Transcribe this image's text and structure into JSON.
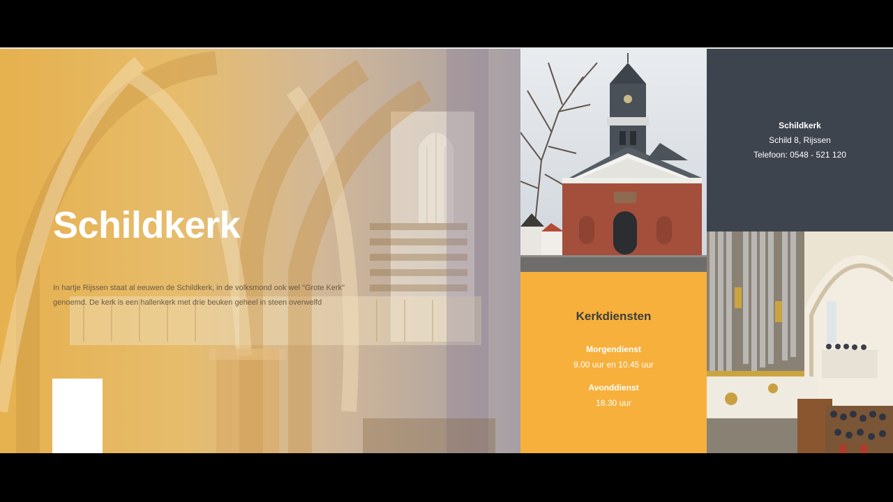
{
  "hero": {
    "title": "Schildkerk",
    "text": "In hartje Rijssen staat al eeuwen de Schildkerk, in de volksmond ook wel \"Grote Kerk\" genoemd. De kerk is een hallenkerk met drie beuken geheel in steen overwelfd"
  },
  "info": {
    "name": "Schildkerk",
    "address": "Schild 8, Rijssen",
    "phone": "Telefoon: 0548 - 521 120"
  },
  "services": {
    "heading": "Kerkdiensten",
    "items": [
      {
        "title": "Morgendienst",
        "time": "9.00 uur en 10.45 uur"
      },
      {
        "title": "Avonddienst",
        "time": "18.30 uur"
      }
    ]
  },
  "colors": {
    "accent": "#f7b03c",
    "info_bg": "#3e444e",
    "letterbox": "#000000"
  }
}
